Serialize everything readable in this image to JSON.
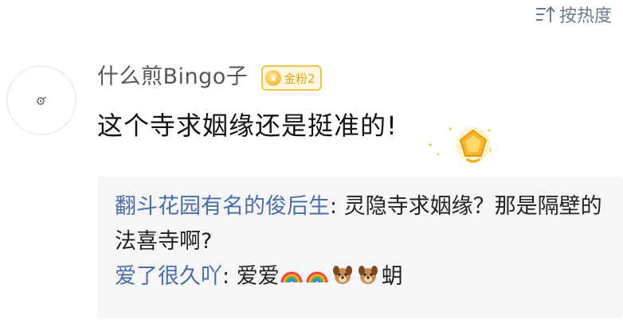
{
  "sort": {
    "label": "按热度",
    "icon": "sort-icon"
  },
  "comment": {
    "username": "什么煎Bingo子",
    "badge": {
      "label": "金粉2",
      "icon": "crown-icon",
      "color": "#f5c24a"
    },
    "text": "这个寺求姻缘还是挺准的!",
    "decoration": "gold-medal-icon"
  },
  "replies": [
    {
      "author": "翻斗花园有名的俊后生",
      "separator": ": ",
      "text": "灵隐寺求姻缘？那是隔壁的法喜寺啊?"
    },
    {
      "author": "爱了很久吖",
      "separator": ": ",
      "text_before": "爱爱",
      "emojis": [
        "rainbow-icon",
        "rainbow-icon",
        "dog-head-icon",
        "dog-head-icon"
      ],
      "text_after": "蚏"
    }
  ],
  "colors": {
    "author_link": "#4a6ea8",
    "reply_background": "#f6f6f8",
    "sort_text": "#6b7a8c"
  }
}
